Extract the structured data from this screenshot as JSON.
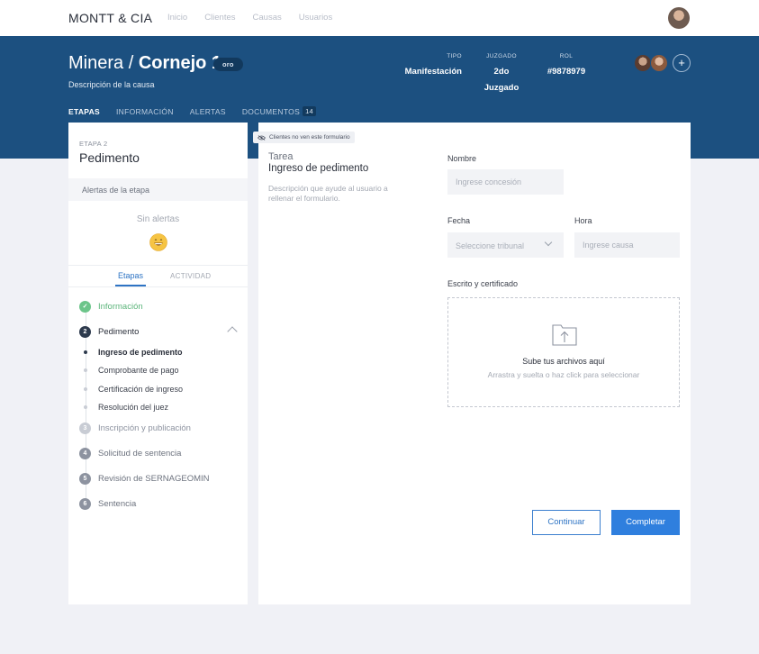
{
  "nav": {
    "brand": "MONTT & CIA",
    "links": [
      "Inicio",
      "Clientes",
      "Causas",
      "Usuarios"
    ]
  },
  "header": {
    "title_prefix": "Minera",
    "title_sep": " / ",
    "title_main": "Cornejo 1",
    "badge": "oro",
    "subtitle": "Descripción de la causa",
    "meta": {
      "tipo_label": "TIPO",
      "tipo_value": "Manifestación",
      "juzgado_label": "JUZGADO",
      "juzgado_value": "2do Juzgado",
      "rol_label": "ROL",
      "rol_value": "#9878979"
    },
    "add_symbol": "+",
    "tabs": [
      {
        "label": "ETAPAS",
        "active": true
      },
      {
        "label": "INFORMACIÓN",
        "active": false
      },
      {
        "label": "ALERTAS",
        "active": false
      },
      {
        "label": "DOCUMENTOS",
        "active": false,
        "count": "14"
      }
    ]
  },
  "sidebar": {
    "etapa_label": "ETAPA 2",
    "etapa_name": "Pedimento",
    "alertas_header": "Alertas de la etapa",
    "sin_alertas": "Sin alertas",
    "subtabs": [
      "Etapas",
      "ACTIVIDAD"
    ],
    "steps": [
      {
        "num": "✓",
        "label": "Información",
        "state": "done"
      },
      {
        "num": "2",
        "label": "Pedimento",
        "state": "current"
      },
      {
        "num": "3",
        "label": "Inscripción y publicación",
        "state": "pending"
      },
      {
        "num": "4",
        "label": "Solicitud de sentencia",
        "state": "pending"
      },
      {
        "num": "5",
        "label": "Revisión de SERNAGEOMIN",
        "state": "pending"
      },
      {
        "num": "6",
        "label": "Sentencia",
        "state": "pending"
      }
    ],
    "substeps": [
      {
        "label": "Ingreso de pedimento",
        "active": true
      },
      {
        "label": "Comprobante de pago",
        "active": false
      },
      {
        "label": "Certificación de ingreso",
        "active": false
      },
      {
        "label": "Resolución del juez",
        "active": false
      }
    ]
  },
  "form": {
    "notice": "Clientes no ven este formulario",
    "tarea_label": "Tarea",
    "tarea_name": "Ingreso de pedimento",
    "tarea_desc": "Descripción que ayude al usuario a rellenar el formulario.",
    "nombre_label": "Nombre",
    "nombre_placeholder": "Ingrese concesión",
    "fecha_label": "Fecha",
    "fecha_select": "Seleccione tribunal",
    "hora_label": "Hora",
    "hora_placeholder": "Ingrese causa",
    "escrito_label": "Escrito y certificado",
    "dropzone_title": "Sube tus archivos aquí",
    "dropzone_sub": "Arrastra y suelta o haz click para seleccionar",
    "continuar": "Continuar",
    "completar": "Completar"
  },
  "colors": {
    "header_bg": "#1c5080",
    "accent": "#2f7fde",
    "done": "#6cc58a"
  },
  "icons": [
    "user-avatar",
    "plus-icon",
    "smiley-icon",
    "eye-off-icon",
    "chevron-up-icon",
    "chevron-down-icon",
    "folder-upload-icon",
    "check-icon"
  ]
}
